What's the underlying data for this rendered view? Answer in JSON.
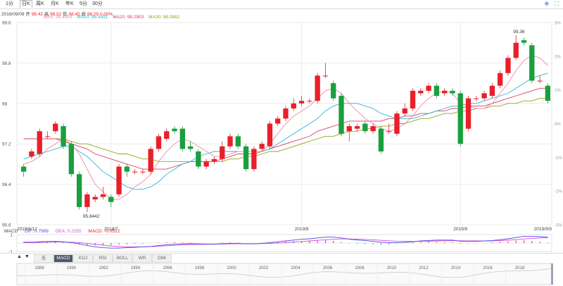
{
  "period_tabs": [
    "1分",
    "日K",
    "周K",
    "月K",
    "年K",
    "5分",
    "30分"
  ],
  "active_tab_index": 1,
  "ohlc": {
    "date": "2019/09/09",
    "open_label": "开",
    "open": "98.42",
    "high_label": "高",
    "high": "98.52",
    "low_label": "低",
    "low": "98.45",
    "close_label": "收",
    "close": "98.29",
    "change_text": "0.00%"
  },
  "ma_legend": {
    "ma5": "MA5: 98.4254",
    "ma10": "MA10: 98.4591",
    "ma20": "MA20: 98.2903",
    "ma30": "MA30: 98.0882"
  },
  "macd_legend": {
    "title": "MACD",
    "dif": "DIF: 0.7999",
    "dea": "DEA: 0.2255",
    "macd": "MACD: -0.0512"
  },
  "indicator_tabs": [
    "无",
    "MACD",
    "KDJ",
    "RSI",
    "BOLL",
    "WR",
    "DMI"
  ],
  "active_indicator": "MACD",
  "nav_years": [
    "1988",
    "1990",
    "1992",
    "1994",
    "1996",
    "1998",
    "2000",
    "2002",
    "2004",
    "2006",
    "2008",
    "2010",
    "2012",
    "2014",
    "2016",
    "2018"
  ],
  "colors": {
    "up": "#e8202a",
    "down": "#1a9f3e",
    "ma5": "#f08ca0",
    "ma10": "#2bb5d6",
    "ma20": "#d6406a",
    "ma30": "#8fa61a",
    "dif": "#4c4ce8",
    "dea": "#d44ce0"
  },
  "chart_data": {
    "type": "candlestick",
    "y_ticks": [
      "95.6",
      "96.4",
      "97.2",
      "98",
      "98.8",
      "99.6"
    ],
    "ylim": [
      95.6,
      99.6
    ],
    "pct_ticks": [
      "3%",
      "2%",
      "1%",
      "0%",
      "-1%",
      "-2%",
      "-3%"
    ],
    "x_labels": [
      "2019/6/12",
      "2019/7",
      "2019/8",
      "2019/9",
      "2019/9/9"
    ],
    "max_label": "99.36",
    "min_label": "95.8442",
    "candles": [
      {
        "o": 96.75,
        "c": 96.65,
        "h": 96.8,
        "l": 96.55
      },
      {
        "o": 96.95,
        "c": 97.05,
        "h": 97.1,
        "l": 96.9
      },
      {
        "o": 97.0,
        "c": 97.45,
        "h": 97.5,
        "l": 96.95
      },
      {
        "o": 97.35,
        "c": 97.35,
        "h": 97.45,
        "l": 97.3
      },
      {
        "o": 97.45,
        "c": 97.6,
        "h": 97.65,
        "l": 97.4
      },
      {
        "o": 97.55,
        "c": 97.15,
        "h": 97.6,
        "l": 97.1
      },
      {
        "o": 97.2,
        "c": 96.6,
        "h": 97.25,
        "l": 96.55
      },
      {
        "o": 96.6,
        "c": 95.95,
        "h": 96.65,
        "l": 95.9
      },
      {
        "o": 95.95,
        "c": 96.2,
        "h": 96.25,
        "l": 95.85
      },
      {
        "o": 96.1,
        "c": 96.15,
        "h": 96.2,
        "l": 96.05
      },
      {
        "o": 96.15,
        "c": 96.2,
        "h": 96.35,
        "l": 96.1
      },
      {
        "o": 96.15,
        "c": 96.05,
        "h": 96.2,
        "l": 95.95
      },
      {
        "o": 96.2,
        "c": 96.75,
        "h": 96.8,
        "l": 96.15
      },
      {
        "o": 96.75,
        "c": 96.65,
        "h": 96.8,
        "l": 96.55
      },
      {
        "o": 96.65,
        "c": 96.65,
        "h": 96.7,
        "l": 96.6
      },
      {
        "o": 96.65,
        "c": 96.65,
        "h": 96.7,
        "l": 96.6
      },
      {
        "o": 96.65,
        "c": 97.1,
        "h": 97.15,
        "l": 96.6
      },
      {
        "o": 97.1,
        "c": 97.35,
        "h": 97.4,
        "l": 97.05
      },
      {
        "o": 97.3,
        "c": 97.45,
        "h": 97.5,
        "l": 97.25
      },
      {
        "o": 97.5,
        "c": 97.45,
        "h": 97.55,
        "l": 97.4
      },
      {
        "o": 97.5,
        "c": 97.1,
        "h": 97.55,
        "l": 97.05
      },
      {
        "o": 97.15,
        "c": 97.1,
        "h": 97.25,
        "l": 97.05
      },
      {
        "o": 97.05,
        "c": 96.75,
        "h": 97.1,
        "l": 96.7
      },
      {
        "o": 96.75,
        "c": 96.85,
        "h": 96.9,
        "l": 96.7
      },
      {
        "o": 96.85,
        "c": 96.9,
        "h": 96.95,
        "l": 96.8
      },
      {
        "o": 96.9,
        "c": 97.15,
        "h": 97.25,
        "l": 96.85
      },
      {
        "o": 97.15,
        "c": 97.35,
        "h": 97.4,
        "l": 97.1
      },
      {
        "o": 97.35,
        "c": 97.15,
        "h": 97.4,
        "l": 97.1
      },
      {
        "o": 97.15,
        "c": 96.7,
        "h": 97.2,
        "l": 96.65
      },
      {
        "o": 96.7,
        "c": 97.1,
        "h": 97.15,
        "l": 96.65
      },
      {
        "o": 97.1,
        "c": 97.2,
        "h": 97.25,
        "l": 97.05
      },
      {
        "o": 97.15,
        "c": 97.6,
        "h": 97.65,
        "l": 97.1
      },
      {
        "o": 97.6,
        "c": 97.7,
        "h": 97.75,
        "l": 97.55
      },
      {
        "o": 97.7,
        "c": 97.9,
        "h": 97.95,
        "l": 97.65
      },
      {
        "o": 97.9,
        "c": 98.0,
        "h": 98.1,
        "l": 97.85
      },
      {
        "o": 98.0,
        "c": 98.05,
        "h": 98.15,
        "l": 97.95
      },
      {
        "o": 98.05,
        "c": 98.05,
        "h": 98.1,
        "l": 98.0
      },
      {
        "o": 98.05,
        "c": 98.55,
        "h": 98.6,
        "l": 98.0
      },
      {
        "o": 98.55,
        "c": 98.55,
        "h": 98.8,
        "l": 98.5
      },
      {
        "o": 98.4,
        "c": 98.1,
        "h": 98.45,
        "l": 98.05
      },
      {
        "o": 98.15,
        "c": 97.4,
        "h": 98.2,
        "l": 97.35
      },
      {
        "o": 97.45,
        "c": 97.55,
        "h": 97.6,
        "l": 97.25
      },
      {
        "o": 97.5,
        "c": 97.55,
        "h": 97.6,
        "l": 97.45
      },
      {
        "o": 97.6,
        "c": 97.45,
        "h": 97.65,
        "l": 97.4
      },
      {
        "o": 97.45,
        "c": 97.55,
        "h": 97.6,
        "l": 97.4
      },
      {
        "o": 97.5,
        "c": 97.05,
        "h": 97.55,
        "l": 97.0
      },
      {
        "o": 97.45,
        "c": 97.45,
        "h": 97.6,
        "l": 97.4
      },
      {
        "o": 97.4,
        "c": 97.8,
        "h": 97.85,
        "l": 97.35
      },
      {
        "o": 97.8,
        "c": 97.9,
        "h": 98.0,
        "l": 97.75
      },
      {
        "o": 97.9,
        "c": 98.25,
        "h": 98.3,
        "l": 97.85
      },
      {
        "o": 98.2,
        "c": 98.25,
        "h": 98.3,
        "l": 98.15
      },
      {
        "o": 98.25,
        "c": 98.35,
        "h": 98.4,
        "l": 98.2
      },
      {
        "o": 98.35,
        "c": 98.15,
        "h": 98.4,
        "l": 98.1
      },
      {
        "o": 98.2,
        "c": 98.25,
        "h": 98.3,
        "l": 98.15
      },
      {
        "o": 98.25,
        "c": 98.2,
        "h": 98.3,
        "l": 98.15
      },
      {
        "o": 98.2,
        "c": 97.2,
        "h": 98.25,
        "l": 97.15
      },
      {
        "o": 97.5,
        "c": 98.1,
        "h": 98.15,
        "l": 97.45
      },
      {
        "o": 98.1,
        "c": 98.1,
        "h": 98.15,
        "l": 98.05
      },
      {
        "o": 98.1,
        "c": 98.2,
        "h": 98.25,
        "l": 98.05
      },
      {
        "o": 98.15,
        "c": 98.35,
        "h": 98.4,
        "l": 98.1
      },
      {
        "o": 98.35,
        "c": 98.6,
        "h": 98.65,
        "l": 98.3
      },
      {
        "o": 98.6,
        "c": 98.9,
        "h": 98.95,
        "l": 98.55
      },
      {
        "o": 98.9,
        "c": 99.2,
        "h": 99.35,
        "l": 98.85
      },
      {
        "o": 99.25,
        "c": 99.2,
        "h": 99.3,
        "l": 99.15
      },
      {
        "o": 99.15,
        "c": 98.45,
        "h": 99.2,
        "l": 98.4
      },
      {
        "o": 98.45,
        "c": 98.45,
        "h": 98.55,
        "l": 98.4
      },
      {
        "o": 98.35,
        "c": 98.05,
        "h": 98.4,
        "l": 98.0
      }
    ],
    "ma5": [
      96.8,
      96.85,
      96.95,
      97.1,
      97.2,
      97.3,
      97.2,
      97.0,
      96.7,
      96.4,
      96.25,
      96.1,
      96.1,
      96.2,
      96.35,
      96.45,
      96.6,
      96.85,
      97.05,
      97.2,
      97.3,
      97.25,
      97.15,
      97.05,
      96.95,
      96.95,
      97.0,
      97.05,
      97.05,
      97.05,
      97.05,
      97.2,
      97.4,
      97.6,
      97.75,
      97.85,
      97.95,
      98.1,
      98.25,
      98.3,
      98.2,
      98.0,
      97.85,
      97.7,
      97.6,
      97.5,
      97.45,
      97.5,
      97.6,
      97.75,
      97.95,
      98.1,
      98.2,
      98.25,
      98.2,
      98.0,
      97.95,
      97.9,
      97.9,
      98.0,
      98.2,
      98.4,
      98.65,
      98.85,
      98.95,
      98.9,
      98.75
    ],
    "ma10": [
      96.9,
      96.95,
      97.0,
      97.05,
      97.1,
      97.15,
      97.15,
      97.05,
      96.95,
      96.8,
      96.65,
      96.55,
      96.45,
      96.35,
      96.3,
      96.3,
      96.35,
      96.45,
      96.6,
      96.7,
      96.8,
      96.85,
      96.95,
      97.0,
      97.05,
      97.05,
      97.05,
      97.05,
      97.05,
      97.05,
      97.05,
      97.1,
      97.2,
      97.3,
      97.4,
      97.5,
      97.6,
      97.7,
      97.85,
      97.95,
      98.0,
      98.0,
      98.0,
      97.95,
      97.9,
      97.8,
      97.75,
      97.7,
      97.7,
      97.7,
      97.75,
      97.8,
      97.85,
      97.9,
      97.95,
      97.95,
      98.0,
      98.0,
      98.05,
      98.1,
      98.15,
      98.2,
      98.3,
      98.4,
      98.5,
      98.55,
      98.6
    ],
    "ma20": [
      97.3,
      97.3,
      97.3,
      97.3,
      97.3,
      97.25,
      97.2,
      97.15,
      97.1,
      97.0,
      96.95,
      96.9,
      96.85,
      96.8,
      96.75,
      96.7,
      96.7,
      96.7,
      96.7,
      96.75,
      96.8,
      96.85,
      96.85,
      96.85,
      96.85,
      96.9,
      96.95,
      97.0,
      97.0,
      97.0,
      97.05,
      97.1,
      97.15,
      97.2,
      97.25,
      97.3,
      97.35,
      97.45,
      97.5,
      97.55,
      97.6,
      97.65,
      97.65,
      97.65,
      97.65,
      97.65,
      97.7,
      97.7,
      97.75,
      97.75,
      97.8,
      97.8,
      97.85,
      97.85,
      97.9,
      97.9,
      97.95,
      97.95,
      97.95,
      98.0,
      98.05,
      98.1,
      98.15,
      98.2,
      98.25,
      98.3,
      98.3
    ],
    "ma30": [
      97.3,
      97.3,
      97.3,
      97.3,
      97.3,
      97.3,
      97.25,
      97.2,
      97.2,
      97.15,
      97.1,
      97.05,
      97.0,
      97.0,
      96.95,
      96.9,
      96.9,
      96.85,
      96.85,
      96.85,
      96.85,
      96.85,
      96.85,
      96.85,
      96.85,
      96.85,
      96.9,
      96.9,
      96.95,
      96.95,
      97.0,
      97.05,
      97.05,
      97.1,
      97.15,
      97.2,
      97.25,
      97.3,
      97.35,
      97.35,
      97.4,
      97.45,
      97.45,
      97.5,
      97.5,
      97.55,
      97.55,
      97.6,
      97.6,
      97.65,
      97.7,
      97.7,
      97.75,
      97.8,
      97.8,
      97.85,
      97.85,
      97.9,
      97.9,
      97.95,
      97.95,
      98.0,
      98.0,
      98.05,
      98.05,
      98.1,
      98.1
    ],
    "macd_ylim": [
      -1,
      1
    ],
    "macd_y_ticks": [
      "1",
      "-1"
    ],
    "macd_hist": [
      0.1,
      0.12,
      0.15,
      0.15,
      0.18,
      0.1,
      0.02,
      -0.15,
      -0.25,
      -0.3,
      -0.3,
      -0.28,
      -0.2,
      -0.15,
      -0.1,
      -0.08,
      -0.02,
      0.05,
      0.1,
      0.12,
      0.08,
      0.05,
      0.0,
      -0.02,
      0.0,
      0.05,
      0.08,
      0.05,
      -0.02,
      0.02,
      0.05,
      0.1,
      0.15,
      0.2,
      0.22,
      0.25,
      0.25,
      0.3,
      0.32,
      0.25,
      0.1,
      -0.05,
      -0.1,
      -0.12,
      -0.15,
      -0.2,
      -0.15,
      -0.05,
      0.0,
      0.08,
      0.12,
      0.15,
      0.12,
      0.1,
      0.08,
      -0.1,
      -0.05,
      -0.02,
      0.02,
      0.08,
      0.15,
      0.2,
      0.28,
      0.3,
      0.25,
      0.15,
      0.05
    ],
    "dif": [
      0.1,
      0.1,
      0.15,
      0.18,
      0.2,
      0.15,
      0.05,
      -0.1,
      -0.3,
      -0.45,
      -0.55,
      -0.6,
      -0.6,
      -0.55,
      -0.5,
      -0.45,
      -0.4,
      -0.3,
      -0.2,
      -0.15,
      -0.1,
      -0.08,
      -0.1,
      -0.12,
      -0.12,
      -0.08,
      -0.05,
      -0.05,
      -0.1,
      -0.1,
      -0.05,
      0.05,
      0.15,
      0.25,
      0.35,
      0.45,
      0.5,
      0.6,
      0.7,
      0.7,
      0.6,
      0.45,
      0.35,
      0.3,
      0.2,
      0.1,
      0.05,
      0.05,
      0.08,
      0.15,
      0.25,
      0.3,
      0.35,
      0.35,
      0.35,
      0.2,
      0.2,
      0.2,
      0.25,
      0.3,
      0.4,
      0.5,
      0.65,
      0.8,
      0.8,
      0.75,
      0.7
    ],
    "dea": [
      0.05,
      0.05,
      0.08,
      0.1,
      0.12,
      0.12,
      0.1,
      0.05,
      -0.05,
      -0.15,
      -0.25,
      -0.35,
      -0.42,
      -0.45,
      -0.45,
      -0.45,
      -0.42,
      -0.38,
      -0.32,
      -0.27,
      -0.22,
      -0.18,
      -0.16,
      -0.15,
      -0.14,
      -0.12,
      -0.1,
      -0.08,
      -0.08,
      -0.08,
      -0.07,
      -0.04,
      0.0,
      0.05,
      0.12,
      0.18,
      0.25,
      0.32,
      0.38,
      0.45,
      0.48,
      0.48,
      0.46,
      0.43,
      0.38,
      0.32,
      0.27,
      0.22,
      0.2,
      0.19,
      0.2,
      0.22,
      0.25,
      0.27,
      0.29,
      0.27,
      0.26,
      0.25,
      0.25,
      0.26,
      0.29,
      0.33,
      0.4,
      0.48,
      0.55,
      0.6,
      0.62
    ]
  }
}
